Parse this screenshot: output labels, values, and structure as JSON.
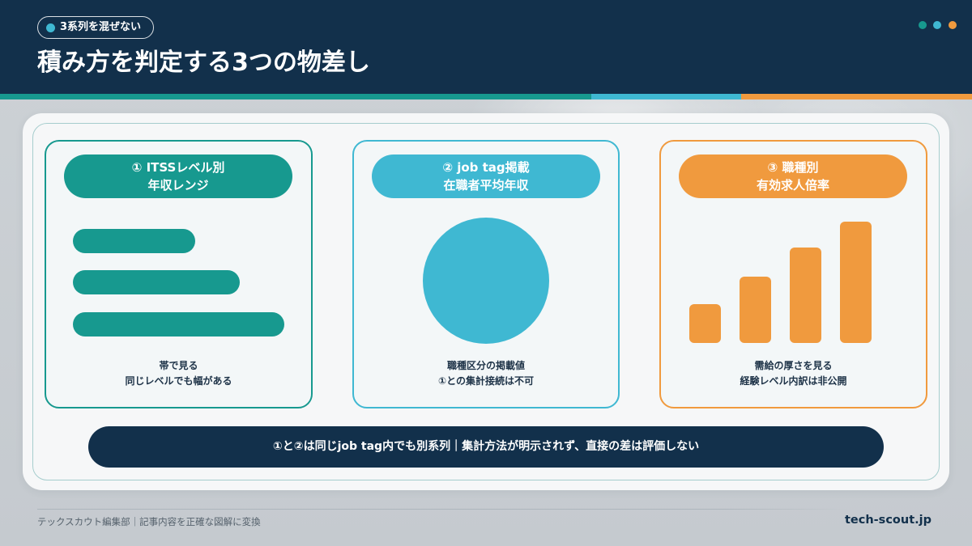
{
  "theme": {
    "navy": "#12304b",
    "teal": "#17998f",
    "blue": "#3fb8d2",
    "orange": "#f09a3e"
  },
  "header": {
    "badge": "3系列を混ぜない",
    "title": "積み方を判定する3つの物差し"
  },
  "cards": [
    {
      "title": [
        "① ITSSレベル別",
        "年収レンジ"
      ],
      "icon": "horizontal-band-bars",
      "caption": [
        "帯で見る",
        "同じレベルでも幅がある"
      ]
    },
    {
      "title": [
        "② job tag掲載",
        "在職者平均年収"
      ],
      "icon": "circle",
      "caption": [
        "職種区分の掲載値",
        "①との集計接続は不可"
      ]
    },
    {
      "title": [
        "③ 職種別",
        "有効求人倍率"
      ],
      "icon": "rising-column-bars",
      "caption": [
        "需給の厚さを見る",
        "経験レベル内訳は非公開"
      ]
    }
  ],
  "banner": "①と②は同じjob tag内でも別系列｜集計方法が明示されず、直接の差は評価しない",
  "footer": {
    "credit": "テックスカウト編集部｜記事内容を正確な図解に変換",
    "site": "tech-scout.jp"
  }
}
